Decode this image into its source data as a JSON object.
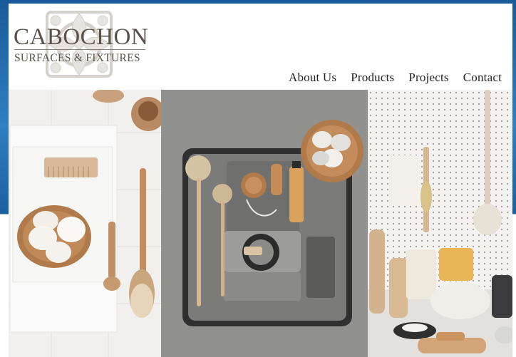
{
  "site": {
    "brand_name": "CABOCHON",
    "brand_tagline": "SURFACES & FIXTURES"
  },
  "nav": {
    "items": [
      {
        "label": "About Us"
      },
      {
        "label": "Products"
      },
      {
        "label": "Projects"
      },
      {
        "label": "Contact"
      }
    ]
  },
  "hero": {
    "panels": [
      {
        "name": "bath-accessories-photo"
      },
      {
        "name": "cleaning-kit-photo"
      },
      {
        "name": "kitchen-pegboard-photo"
      }
    ]
  },
  "colors": {
    "brand_text": "#5a5148",
    "nav_text": "#222222",
    "backdrop_blue": "#2f7fc2"
  }
}
